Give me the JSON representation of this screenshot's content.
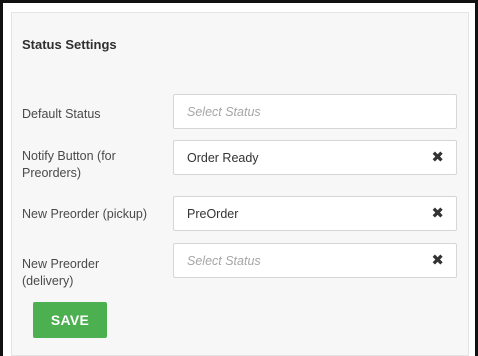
{
  "panel": {
    "title": "Status Settings"
  },
  "fields": [
    {
      "label": "Default Status",
      "value": "",
      "placeholder": "Select Status",
      "clearable": false
    },
    {
      "label": "Notify Button (for Preorders)",
      "value": "Order Ready",
      "placeholder": "",
      "clearable": true
    },
    {
      "label": "New Preorder (pickup)",
      "value": "PreOrder",
      "placeholder": "",
      "clearable": true
    },
    {
      "label": "New Preorder (delivery)",
      "value": "",
      "placeholder": "Select Status",
      "clearable": true
    }
  ],
  "actions": {
    "save_label": "SAVE"
  },
  "icons": {
    "clear": "close-icon"
  },
  "colors": {
    "save_button": "#4caf50",
    "placeholder_text": "#a6a6a6"
  }
}
